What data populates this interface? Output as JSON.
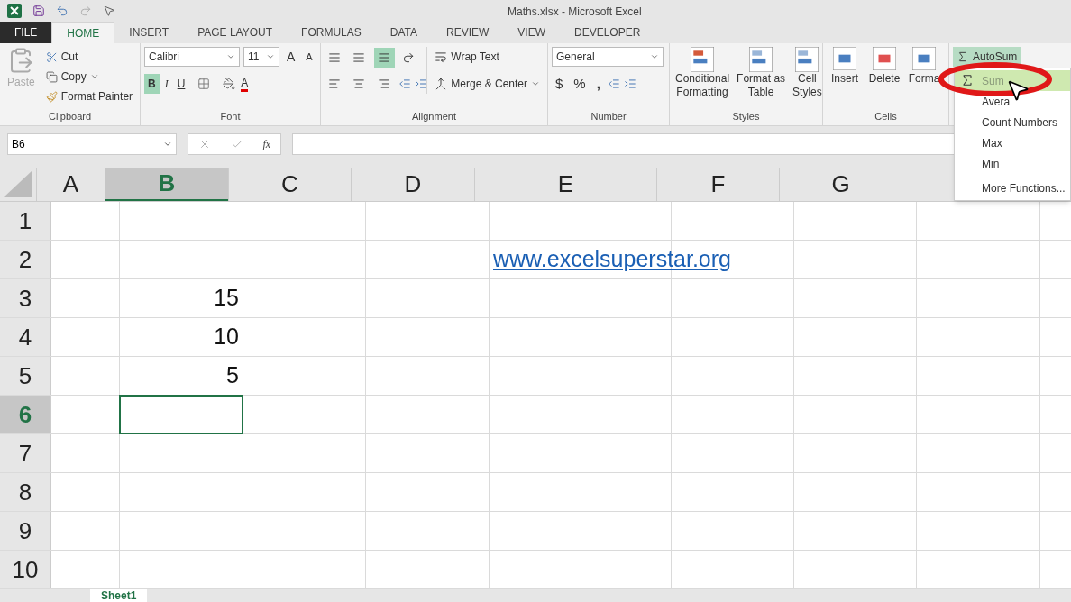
{
  "title_bar": {
    "title": "Maths.xlsx - Microsoft Excel"
  },
  "ribbon_tabs": [
    {
      "label": "FILE",
      "kind": "file",
      "selected": false
    },
    {
      "label": "HOME",
      "kind": "tab",
      "selected": true
    },
    {
      "label": "INSERT",
      "kind": "tab",
      "selected": false
    },
    {
      "label": "PAGE LAYOUT",
      "kind": "tab",
      "selected": false
    },
    {
      "label": "FORMULAS",
      "kind": "tab",
      "selected": false
    },
    {
      "label": "DATA",
      "kind": "tab",
      "selected": false
    },
    {
      "label": "REVIEW",
      "kind": "tab",
      "selected": false
    },
    {
      "label": "VIEW",
      "kind": "tab",
      "selected": false
    },
    {
      "label": "DEVELOPER",
      "kind": "tab",
      "selected": false
    }
  ],
  "clipboard": {
    "paste": "Paste",
    "cut": "Cut",
    "copy": "Copy",
    "format_painter": "Format Painter",
    "label": "Clipboard"
  },
  "font": {
    "name": "Calibri",
    "size": "11",
    "grow": "A",
    "shrink": "A",
    "bold": "B",
    "bold_on": true,
    "italic": "I",
    "underline": "U",
    "font_color": "A",
    "label": "Font"
  },
  "alignment": {
    "bottom_align_on": true,
    "wrap_text": "Wrap Text",
    "merge_center": "Merge & Center",
    "label": "Alignment"
  },
  "number": {
    "format": "General",
    "currency": "$",
    "percent": "%",
    "comma": ",",
    "label": "Number"
  },
  "styles": {
    "buttons": [
      {
        "line1": "Conditional",
        "line2": "Formatting"
      },
      {
        "line1": "Format as",
        "line2": "Table"
      },
      {
        "line1": "Cell",
        "line2": "Styles"
      }
    ],
    "label": "Styles"
  },
  "cells": {
    "buttons": [
      "Insert",
      "Delete",
      "Forma"
    ],
    "label": "Cells"
  },
  "editing": {
    "autosum": "AutoSum"
  },
  "autosum_menu": [
    {
      "label": "Sum",
      "selected": true
    },
    {
      "label": "Avera",
      "selected": false
    },
    {
      "label": "Count Numbers",
      "selected": false
    },
    {
      "label": "Max",
      "selected": false
    },
    {
      "label": "Min",
      "selected": false
    },
    {
      "label": "More Functions...",
      "selected": false
    }
  ],
  "formula_bar": {
    "name_box": "B6",
    "fx": "fx"
  },
  "columns": [
    {
      "label": "A",
      "selected": false
    },
    {
      "label": "B",
      "selected": true
    },
    {
      "label": "C",
      "selected": false
    },
    {
      "label": "D",
      "selected": false
    },
    {
      "label": "E",
      "selected": false
    },
    {
      "label": "F",
      "selected": false
    },
    {
      "label": "G",
      "selected": false
    }
  ],
  "rows": [
    {
      "label": "1",
      "selected": false,
      "cells": []
    },
    {
      "label": "2",
      "selected": false,
      "cells": [
        {},
        {},
        {},
        {},
        {
          "value": "www.excelsuperstar.org",
          "kind": "link"
        }
      ]
    },
    {
      "label": "3",
      "selected": false,
      "cells": [
        {},
        {
          "value": "15",
          "kind": "number"
        }
      ]
    },
    {
      "label": "4",
      "selected": false,
      "cells": [
        {},
        {
          "value": "10",
          "kind": "number"
        }
      ]
    },
    {
      "label": "5",
      "selected": false,
      "cells": [
        {},
        {
          "value": "5",
          "kind": "number"
        }
      ]
    },
    {
      "label": "6",
      "selected": true,
      "cells": []
    },
    {
      "label": "7",
      "selected": false,
      "cells": []
    },
    {
      "label": "8",
      "selected": false,
      "cells": []
    },
    {
      "label": "9",
      "selected": false,
      "cells": []
    },
    {
      "label": "10",
      "selected": false,
      "cells": []
    }
  ],
  "sheet_tabs": [
    {
      "label": "Sheet1",
      "selected": true
    }
  ],
  "annotation": {
    "kind": "ellipse"
  }
}
